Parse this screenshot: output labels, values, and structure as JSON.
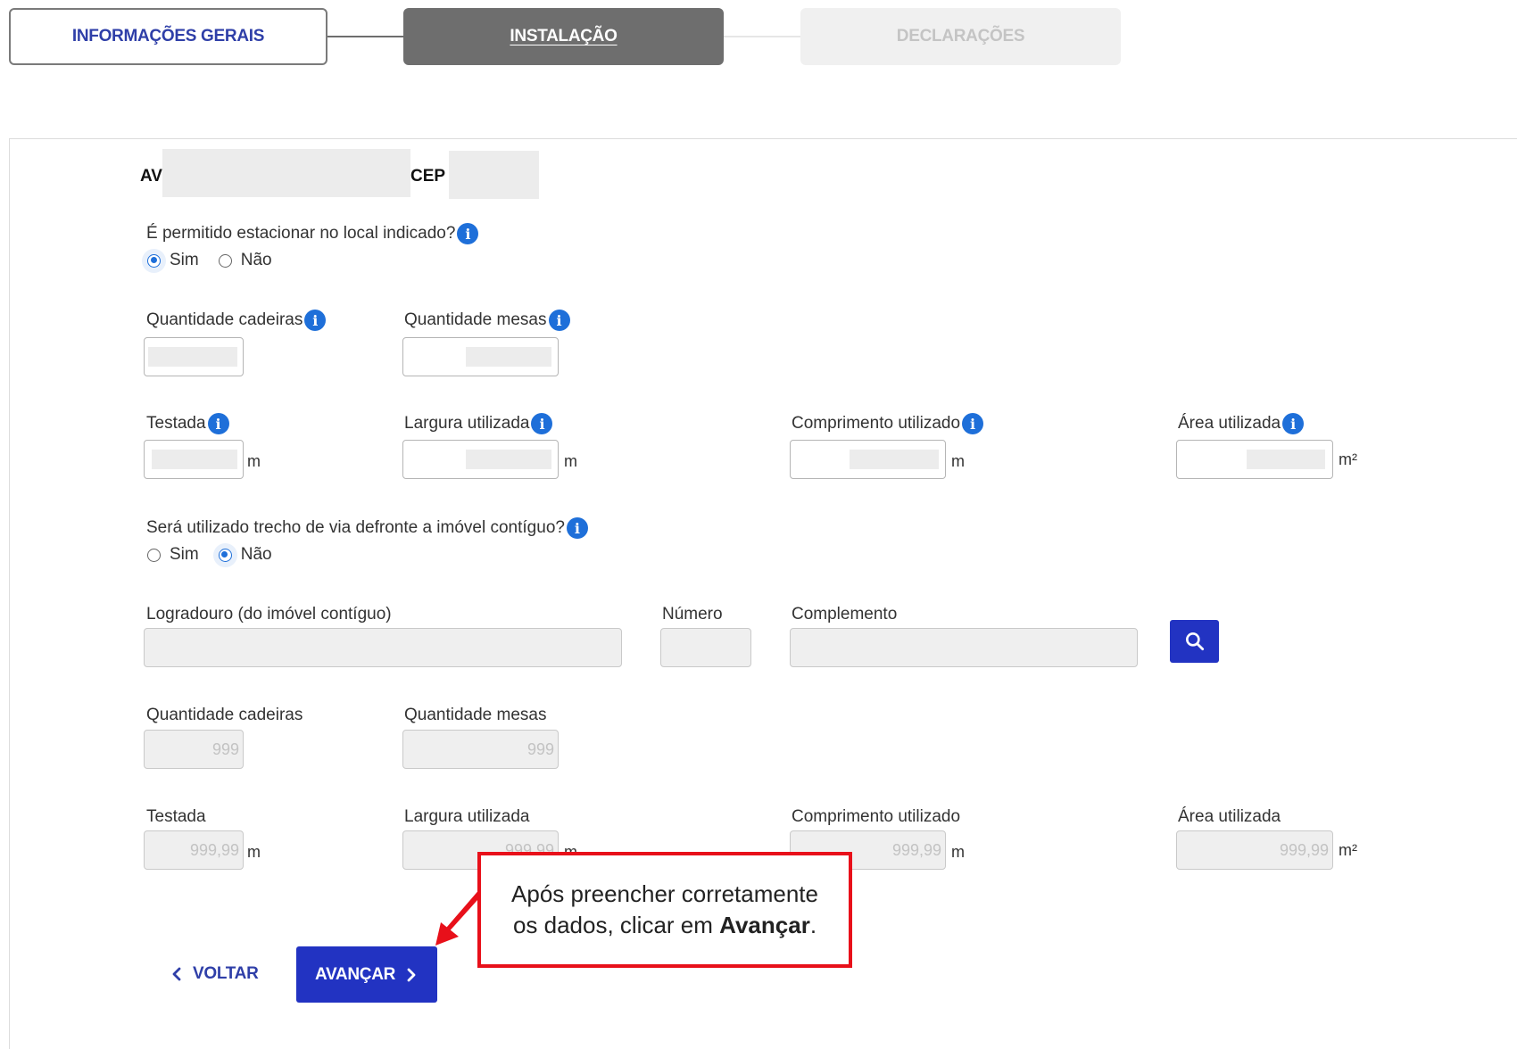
{
  "stepper": {
    "steps": [
      {
        "label": "INFORMAÇÕES GERAIS",
        "state": "done"
      },
      {
        "label": "INSTALAÇÃO",
        "state": "active"
      },
      {
        "label": "DECLARAÇÕES",
        "state": "disabled"
      }
    ]
  },
  "address": {
    "street_prefix": "AV",
    "cep_label": "CEP"
  },
  "parking": {
    "question": "É permitido estacionar no local indicado?",
    "options": [
      "Sim",
      "Não"
    ],
    "selected": "Sim"
  },
  "section1": {
    "cadeiras_label": "Quantidade cadeiras",
    "mesas_label": "Quantidade mesas",
    "testada_label": "Testada",
    "largura_label": "Largura utilizada",
    "comprimento_label": "Comprimento utilizado",
    "area_label": "Área utilizada",
    "unit_m": "m",
    "unit_m2": "m²"
  },
  "contiguous": {
    "question": "Será utilizado trecho de via defronte a imóvel contíguo?",
    "options": [
      "Sim",
      "Não"
    ],
    "selected": "Não"
  },
  "contiguous_address": {
    "logradouro_label": "Logradouro (do imóvel contíguo)",
    "numero_label": "Número",
    "complemento_label": "Complemento"
  },
  "section2": {
    "cadeiras_label": "Quantidade cadeiras",
    "mesas_label": "Quantidade mesas",
    "cadeiras_placeholder": "999",
    "mesas_placeholder": "999",
    "testada_label": "Testada",
    "largura_label": "Largura utilizada",
    "comprimento_label": "Comprimento utilizado",
    "area_label": "Área utilizada",
    "decimal_placeholder": "999,99",
    "unit_m": "m",
    "unit_m2": "m²"
  },
  "actions": {
    "back_label": "VOLTAR",
    "next_label": "AVANÇAR"
  },
  "callout": {
    "text_before": "Após preencher corretamente os dados, clicar em ",
    "text_bold": "Avançar",
    "text_after": "."
  },
  "colors": {
    "primary": "#2233c2",
    "info": "#1e6fd9",
    "callout_border": "#e8101a",
    "step_active": "#6e6e6e"
  }
}
